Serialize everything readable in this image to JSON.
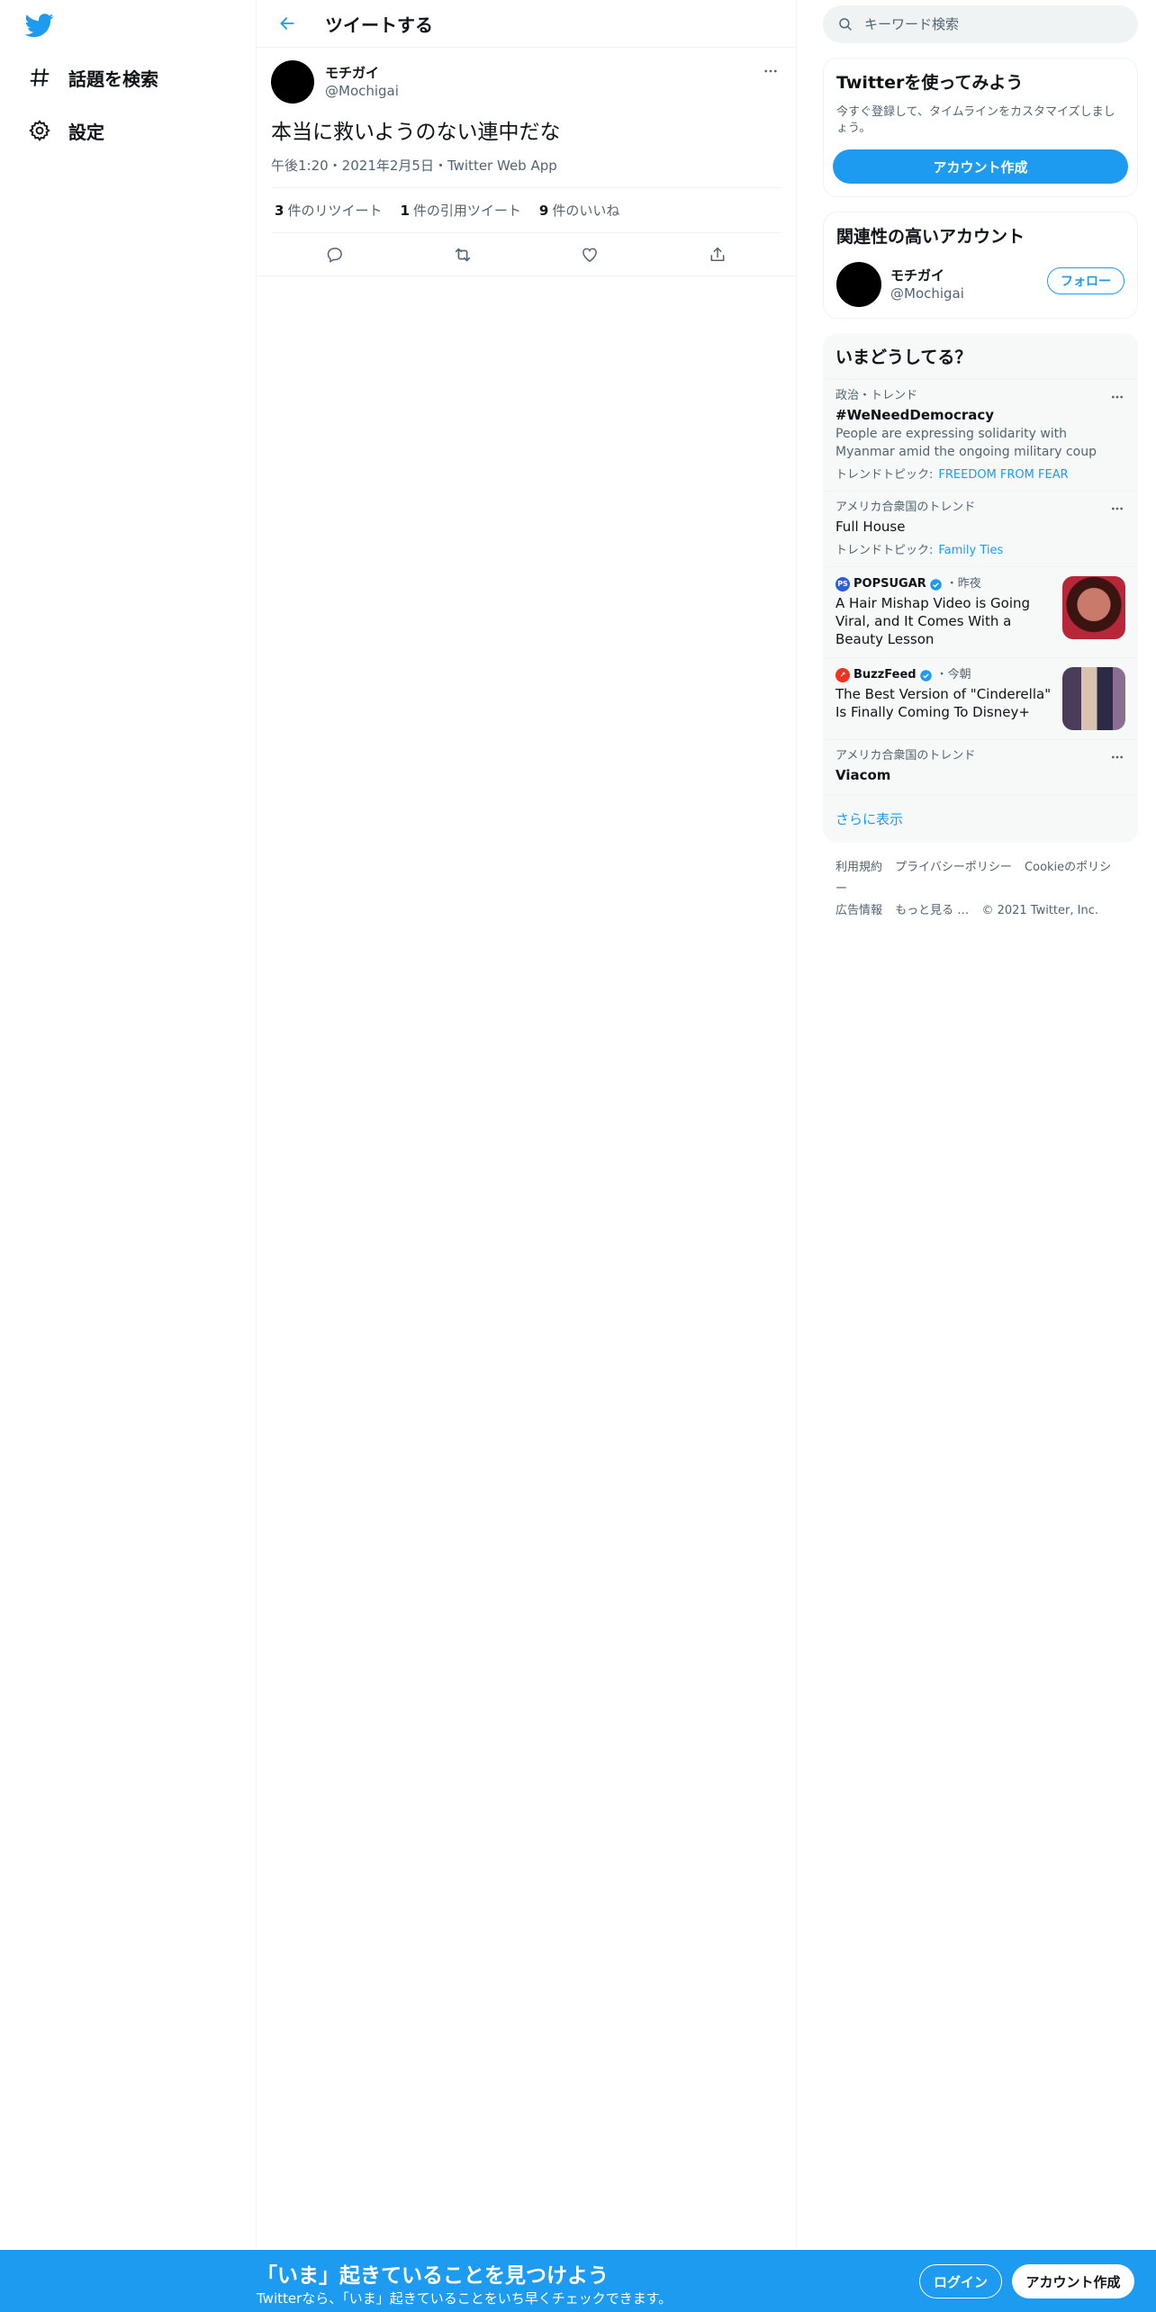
{
  "nav": {
    "logo_icon": "twitter-bird-icon",
    "items": [
      {
        "label": "話題を検索",
        "icon": "hashtag-icon"
      },
      {
        "label": "設定",
        "icon": "gear-icon"
      }
    ]
  },
  "main": {
    "header_title": "ツイートする",
    "tweet": {
      "display_name": "モチガイ",
      "handle": "@Mochigai",
      "text": "本当に救いようのない連中だな",
      "meta": "午後1:20・2021年2月5日・Twitter Web App",
      "stats": [
        {
          "count": "3",
          "label": "件のリツイート"
        },
        {
          "count": "1",
          "label": "件の引用ツイート"
        },
        {
          "count": "9",
          "label": "件のいいね"
        }
      ]
    }
  },
  "sidebar": {
    "search_placeholder": "キーワード検索",
    "signup_card": {
      "title": "Twitterを使ってみよう",
      "desc": "今すぐ登録して、タイムラインをカスタマイズしましょう。",
      "button": "アカウント作成"
    },
    "related": {
      "title": "関連性の高いアカウント",
      "name": "モチガイ",
      "handle": "@Mochigai",
      "follow": "フォロー"
    },
    "trends": {
      "title": "いまどうしてる？",
      "items": [
        {
          "category": "政治・トレンド",
          "name": "#WeNeedDemocracy",
          "desc": "People are expressing solidarity with Myanmar amid the ongoing military coup",
          "topic_label": "トレンドトピック:",
          "topic": "FREEDOM FROM FEAR"
        },
        {
          "category": "アメリカ合衆国のトレンド",
          "name": "Full House",
          "topic_label": "トレンドトピック:",
          "topic": "Family Ties"
        },
        {
          "category": "アメリカ合衆国のトレンド",
          "name": "Viacom"
        }
      ],
      "news": [
        {
          "source": "POPSUGAR",
          "logo": "PS",
          "time": "・昨夜",
          "title": "A Hair Mishap Video is Going Viral, and It Comes With a Beauty Lesson"
        },
        {
          "source": "BuzzFeed",
          "logo": "↗",
          "time": "・今朝",
          "title": "The Best Version of \"Cinderella\" Is Finally Coming To Disney+"
        }
      ],
      "show_more": "さらに表示"
    },
    "footer": {
      "links": [
        "利用規約",
        "プライバシーポリシー",
        "Cookieのポリシー",
        "広告情報",
        "もっと見る …",
        "© 2021 Twitter, Inc."
      ]
    }
  },
  "bottom_bar": {
    "title": "「いま」起きていることを見つけよう",
    "subtitle": "Twitterなら、「いま」起きていることをいち早くチェックできます。",
    "login": "ログイン",
    "signup": "アカウント作成"
  },
  "colors": {
    "accent": "#1d9bf0",
    "text_primary": "#0f1419",
    "text_secondary": "#536471",
    "border": "#eff3f4",
    "popsugar": "#2b5fd9",
    "buzzfeed": "#ee3322"
  }
}
